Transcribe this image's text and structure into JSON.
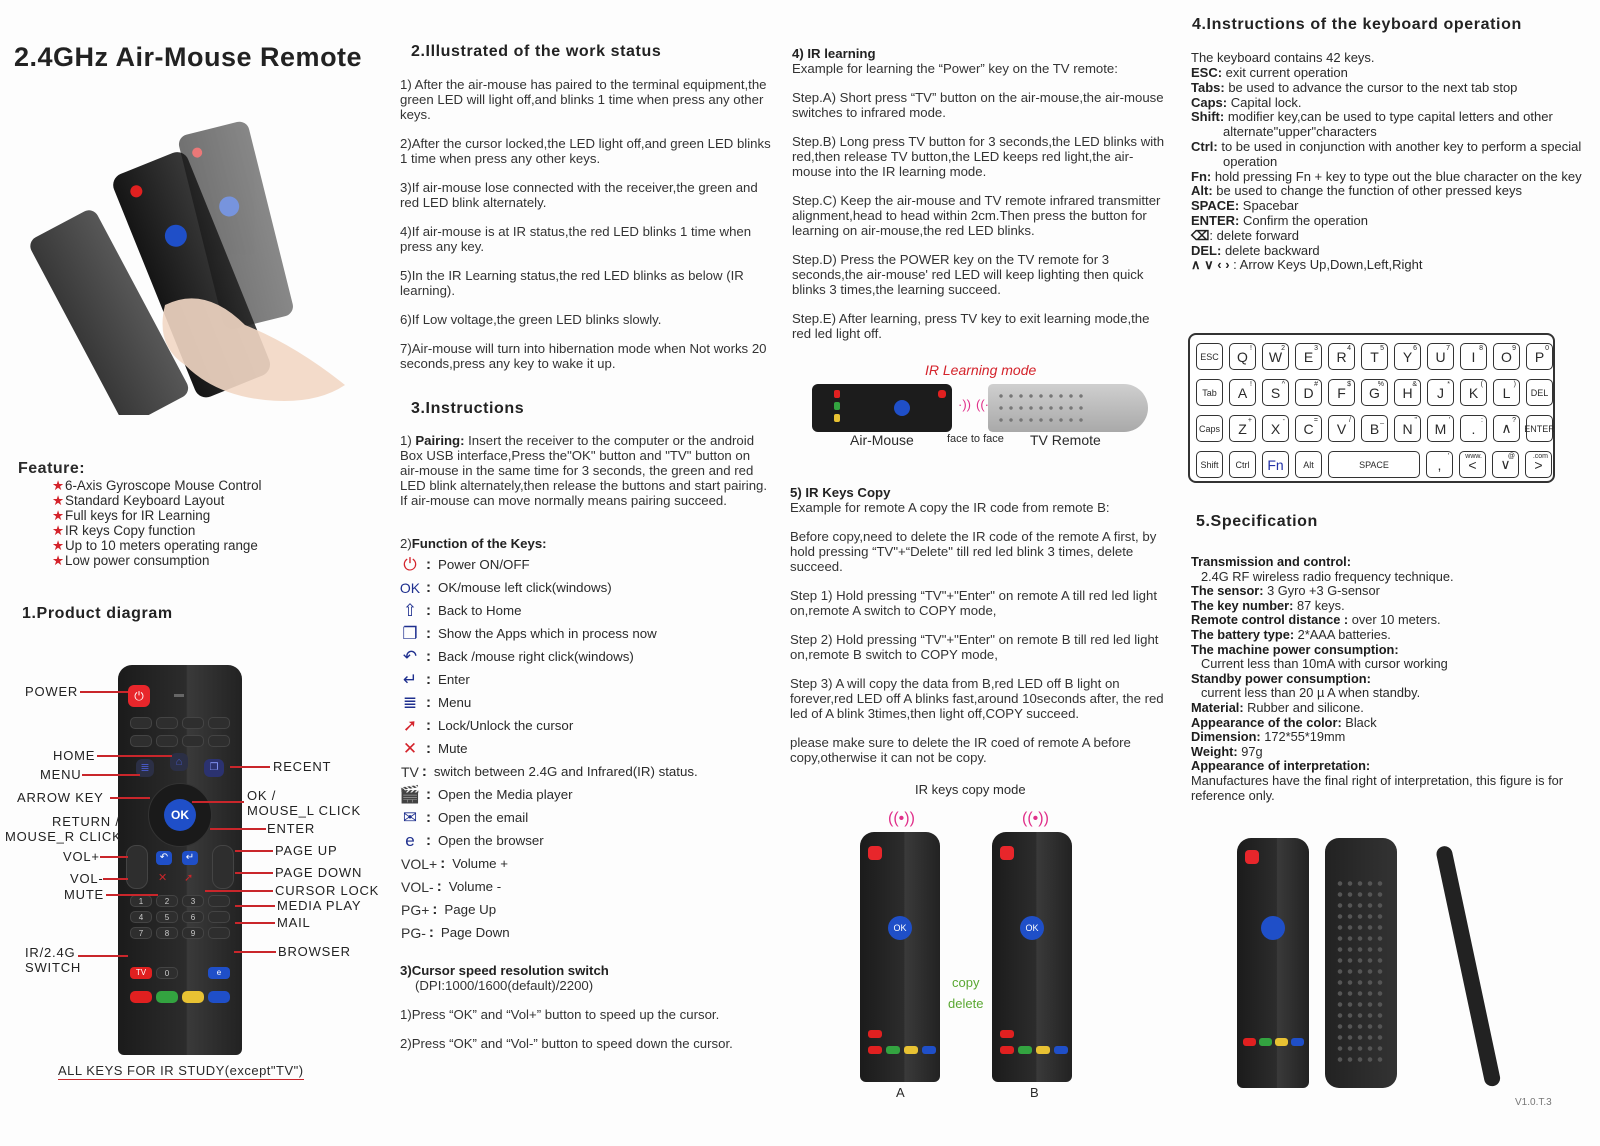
{
  "title": "2.4GHz  Air-Mouse Remote",
  "features": {
    "heading": "Feature:",
    "items": [
      "6-Axis Gyroscope Mouse Control",
      "Standard Keyboard Layout",
      "Full keys for IR Learning",
      "IR keys Copy function",
      "Up to 10 meters operating range",
      "Low power consumption"
    ]
  },
  "product_diagram": {
    "heading": "1.Product diagram",
    "labels": {
      "power": "POWER",
      "home": "HOME",
      "menu": "MENU",
      "arrow_key": "ARROW  KEY",
      "return_1": "RETURN /",
      "return_2": "MOUSE_R CLICK",
      "vol_plus": "VOL+",
      "vol_minus": "VOL-",
      "mute": "MUTE",
      "ir_switch_1": "IR/2.4G",
      "ir_switch_2": "SWITCH",
      "recent": "RECENT",
      "ok_1": "OK /",
      "ok_2": "MOUSE_L CLICK",
      "enter": "ENTER",
      "page_up": "PAGE UP",
      "page_down": "PAGE DOWN",
      "cursor_lock": "CURSOR LOCK",
      "media_play": "MEDIA PLAY",
      "mail": "MAIL",
      "browser": "BROWSER"
    },
    "ok_label": "OK",
    "tv_label": "TV",
    "numbers": [
      "1",
      "2",
      "3",
      "4",
      "5",
      "6",
      "7",
      "8",
      "9",
      "0"
    ],
    "footnote": "ALL KEYS FOR IR STUDY(except\"TV\")"
  },
  "work_status": {
    "heading": "2.Illustrated of the work status",
    "items": [
      "1) After the air-mouse has paired to the terminal equipment,the green LED will light off,and  blinks 1 time when press any other keys.",
      "2)After the cursor locked,the LED light off,and green LED blinks 1 time when press any other keys.",
      "3)If air-mouse lose connected with the receiver,the green and red LED blink alternately.",
      "4)If air-mouse is at IR status,the red LED blinks 1 time when press any key.",
      "5)In the IR Learning status,the red LED blinks as below (IR learning).",
      "6)If Low voltage,the green LED blinks slowly.",
      "7)Air-mouse will turn into hibernation mode when Not works 20 seconds,press any key to wake it up."
    ]
  },
  "instructions": {
    "heading": "3.Instructions",
    "pairing_prefix": "1) ",
    "pairing_label": "Pairing:",
    "pairing_text": " Insert the receiver to the computer or the android Box USB interface,Press the\"OK\" button and \"TV\" button on air-mouse in the same time for 3 seconds, the green and red LED blink alternately,then release the buttons and start pairing. If air-mouse can move normally means pairing succeed.",
    "keys_prefix": "2)",
    "keys_heading": "Function of the Keys:",
    "keys": [
      {
        "icon": "power-icon",
        "glyph": "⏻",
        "desc": "Power ON/OFF"
      },
      {
        "icon": "ok-icon",
        "glyph": "OK",
        "desc": "OK/mouse left click(windows)"
      },
      {
        "icon": "home-icon",
        "glyph": "⇧",
        "desc": "Back to Home"
      },
      {
        "icon": "recent-apps-icon",
        "glyph": "❐",
        "desc": "Show the Apps which in process now"
      },
      {
        "icon": "back-icon",
        "glyph": "↶",
        "desc": "Back /mouse right click(windows)"
      },
      {
        "icon": "enter-icon",
        "glyph": "↵",
        "desc": "Enter"
      },
      {
        "icon": "menu-icon",
        "glyph": "≣",
        "desc": "Menu"
      },
      {
        "icon": "cursor-lock-icon",
        "glyph": "➚",
        "desc": "Lock/Unlock the cursor"
      },
      {
        "icon": "mute-icon",
        "glyph": "✕",
        "desc": "Mute"
      },
      {
        "icon": "tv-icon",
        "glyph": "TV",
        "desc": "switch between 2.4G and Infrared(IR) status."
      },
      {
        "icon": "media-player-icon",
        "glyph": "🎬",
        "desc": "Open the  Media player"
      },
      {
        "icon": "email-icon",
        "glyph": "✉",
        "desc": "Open the email"
      },
      {
        "icon": "browser-icon",
        "glyph": "e",
        "desc": "Open the browser"
      },
      {
        "icon": "vol-plus-icon",
        "glyph": "VOL+",
        "desc": "Volume +"
      },
      {
        "icon": "vol-minus-icon",
        "glyph": "VOL-",
        "desc": "Volume -"
      },
      {
        "icon": "page-up-icon",
        "glyph": "PG+",
        "desc": "Page Up"
      },
      {
        "icon": "page-down-icon",
        "glyph": "PG-",
        "desc": "Page Down"
      }
    ],
    "cursor_heading": "3)Cursor speed resolution switch",
    "cursor_dpi": "(DPI:1000/1600(default)/2200)",
    "cursor_steps": [
      "1)Press “OK” and “Vol+” button to speed up the cursor.",
      "2)Press “OK” and “Vol-” button  to speed down the cursor."
    ]
  },
  "ir_learning": {
    "heading": "4) IR learning",
    "intro": "Example for learning the “Power” key on the TV remote:",
    "steps": [
      "Step.A) Short press “TV” button on the air-mouse,the air-mouse switches to infrared mode.",
      "Step.B) Long press TV button for 3 seconds,the LED blinks with red,then release TV button,the LED keeps red light,the air-mouse into the IR learning mode.",
      "Step.C) Keep the air-mouse and TV remote infrared transmitter alignment,head to head within 2cm.Then press the button for learning on air-mouse,the red LED blinks.",
      "Step.D) Press the POWER key on the TV remote for 3 seconds,the air-mouse' red LED will keep lighting then quick blinks 3 times,the learning succeed.",
      "Step.E) After learning, press TV key to exit learning mode,the red led light off."
    ],
    "figure_title": "IR Learning mode",
    "figure_left": "Air-Mouse",
    "figure_middle": "face to face",
    "figure_right": "TV Remote"
  },
  "ir_copy": {
    "heading": "5) IR Keys Copy",
    "intro": "Example for remote  A copy the IR code from remote B:",
    "paragraphs": [
      "Before copy,need to delete the IR code of the remote A first, by hold pressing “TV\"+“Delete\" till red led blink 3 times, delete succeed.",
      "Step 1) Hold pressing “TV\"+\"Enter\" on remote A  till red led light on,remote A switch to COPY mode,",
      "Step 2) Hold pressing “TV\"+\"Enter\" on remote B till red led light on,remote B switch to COPY mode,",
      "Step 3) A will copy the data from B,red LED off B light on forever,red LED off A blinks fast,around 10seconds after, the red led of A blink 3times,then light off,COPY succeed.",
      "please make sure to delete the IR coed of remote A before copy,otherwise it can not be copy."
    ],
    "figure_title": "IR keys copy mode",
    "copy_label": "copy",
    "delete_label": "delete",
    "remote_a": "A",
    "remote_b": "B"
  },
  "keyboard_ops": {
    "heading": "4.Instructions of the keyboard operation",
    "intro": "The keyboard contains 42 keys.",
    "items": [
      {
        "key": "ESC:",
        "desc": " exit  current operation"
      },
      {
        "key": "Tabs:",
        "desc": " be used to advance the cursor to the next tab stop"
      },
      {
        "key": "Caps:",
        "desc": " Capital lock."
      },
      {
        "key": "Shift:",
        "desc": " modifier key,can be used to type capital letters and other alternate\"upper\"characters"
      },
      {
        "key": "Ctrl:",
        "desc": " to be used in conjunction with another key to perform a special operation"
      },
      {
        "key": "Fn:",
        "desc": " hold pressing Fn + key to type out the blue character on the key"
      },
      {
        "key": "Alt:",
        "desc": " be used to change the function of other pressed keys"
      },
      {
        "key": "SPACE:",
        "desc": " Spacebar"
      },
      {
        "key": "ENTER:",
        "desc": " Confirm the operation"
      },
      {
        "key": "⌫",
        "desc": ": delete forward"
      },
      {
        "key": "DEL:",
        "desc": " delete backward"
      },
      {
        "key": "∧ ∨ ‹ ›",
        "desc": " : Arrow Keys Up,Down,Left,Right"
      }
    ],
    "rows": [
      [
        [
          "ESC",
          ""
        ],
        [
          "Q",
          "!"
        ],
        [
          "W",
          "2"
        ],
        [
          "E",
          "3"
        ],
        [
          "R",
          "4"
        ],
        [
          "T",
          "5"
        ],
        [
          "Y",
          "6"
        ],
        [
          "U",
          "7"
        ],
        [
          "I",
          "8"
        ],
        [
          "O",
          "9"
        ],
        [
          "P",
          "0"
        ]
      ],
      [
        [
          "Tab",
          ""
        ],
        [
          "A",
          "!"
        ],
        [
          "S",
          "^"
        ],
        [
          "D",
          "#"
        ],
        [
          "F",
          "$"
        ],
        [
          "G",
          "%"
        ],
        [
          "H",
          "&"
        ],
        [
          "J",
          "*"
        ],
        [
          "K",
          "("
        ],
        [
          "L",
          ")"
        ],
        [
          "DEL",
          ""
        ]
      ],
      [
        [
          "Caps",
          ""
        ],
        [
          "Z",
          "+"
        ],
        [
          "X",
          "-"
        ],
        [
          "C",
          "="
        ],
        [
          "V",
          "/"
        ],
        [
          "B",
          "_"
        ],
        [
          "N",
          "\""
        ],
        [
          "M",
          "'"
        ],
        [
          ".",
          ":"
        ],
        [
          "∧",
          "?"
        ],
        [
          "ENTER",
          ""
        ]
      ],
      [
        [
          "Shift",
          ""
        ],
        [
          "Ctrl",
          ""
        ],
        [
          "Fn",
          ""
        ],
        [
          "Alt",
          ""
        ],
        [
          "SPACE",
          ""
        ],
        [
          ",",
          "'"
        ],
        [
          "<",
          "www."
        ],
        [
          "∨",
          "@"
        ],
        [
          ">",
          ".com"
        ]
      ]
    ]
  },
  "specification": {
    "heading": "5.Specification",
    "items": [
      {
        "label": "Transmission and control:",
        "value": "2.4G RF wireless radio frequency technique.",
        "newline": true
      },
      {
        "label": "The sensor:",
        "value": " 3 Gyro +3 G-sensor",
        "newline": false
      },
      {
        "label": "The key number:",
        "value": " 87 keys.",
        "newline": false
      },
      {
        "label": "Remote control distance :",
        "value": " over 10 meters.",
        "newline": false
      },
      {
        "label": "The battery type:",
        "value": " 2*AAA batteries.",
        "newline": false
      },
      {
        "label": "The machine power consumption:",
        "value": "Current less than 10mA with cursor working",
        "newline": true
      },
      {
        "label": "Standby power consumption:",
        "value": "current less than 20 µ A when standby.",
        "newline": true
      },
      {
        "label": "Material:",
        "value": " Rubber and silicone.",
        "newline": false
      },
      {
        "label": "Appearance of the color:",
        "value": " Black",
        "newline": false
      },
      {
        "label": "Dimension:",
        "value": " 172*55*19mm",
        "newline": false
      },
      {
        "label": "Weight:",
        "value": " 97g",
        "newline": false
      },
      {
        "label": "Appearance of interpretation:",
        "value": "Manufactures have the final right of interpretation, this figure is for reference only.",
        "newline": true
      }
    ]
  },
  "version": "V1.0.T.3",
  "colors": {
    "accent_red": "#c9262b",
    "icon_blue": "#1e2f8e",
    "ok_blue": "#1f4fc8",
    "tv_red": "#e02020",
    "green_label": "#5aa832",
    "ir_pink": "#e0308a"
  }
}
